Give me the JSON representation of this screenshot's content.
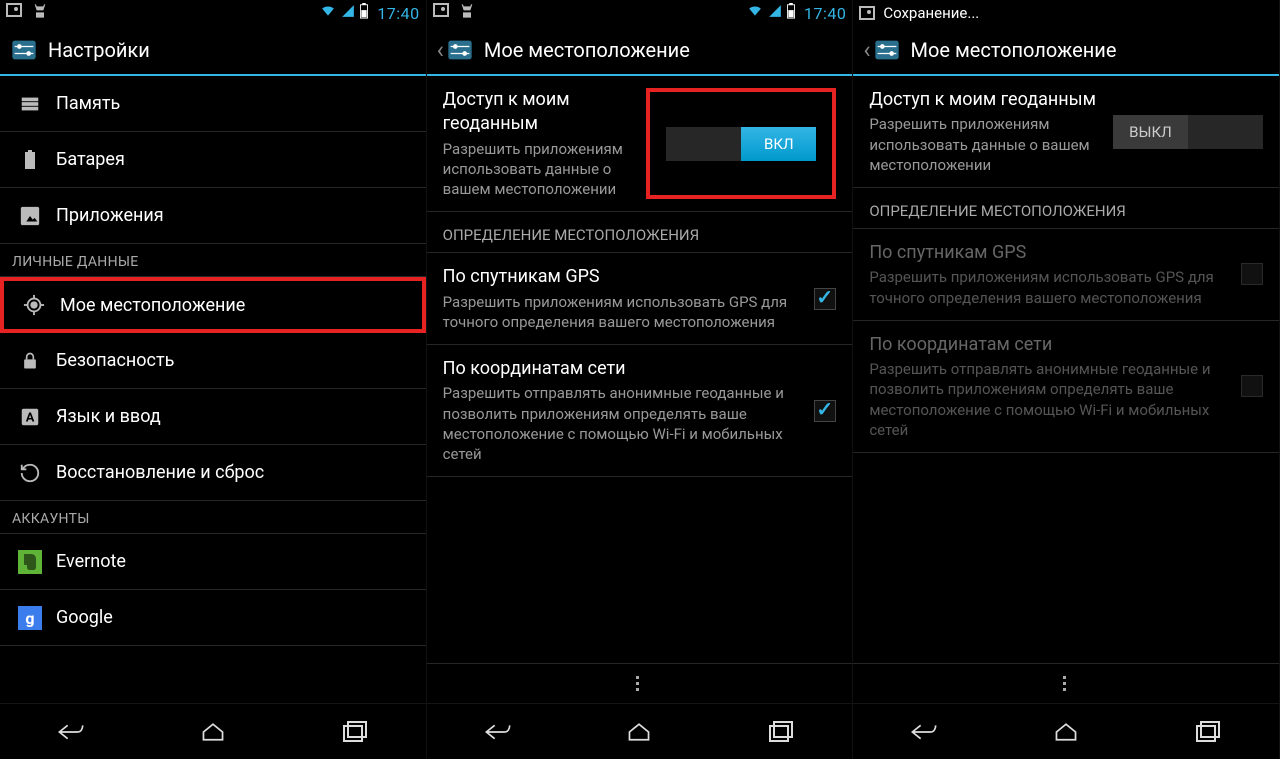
{
  "status": {
    "time": "17:40",
    "saving": "Сохранение..."
  },
  "screen1": {
    "title": "Настройки",
    "items": [
      {
        "icon": "memory",
        "label": "Память"
      },
      {
        "icon": "battery",
        "label": "Батарея"
      },
      {
        "icon": "apps",
        "label": "Приложения"
      }
    ],
    "section_personal": "ЛИЧНЫЕ ДАННЫЕ",
    "personal_items": [
      {
        "icon": "location",
        "label": "Мое местоположение"
      },
      {
        "icon": "lock",
        "label": "Безопасность"
      },
      {
        "icon": "lang",
        "label": "Язык и ввод"
      },
      {
        "icon": "restore",
        "label": "Восстановление и сброс"
      }
    ],
    "section_accounts": "АККАУНТЫ",
    "accounts": [
      {
        "icon": "evernote",
        "label": "Evernote"
      },
      {
        "icon": "google",
        "label": "Google"
      }
    ]
  },
  "screen2": {
    "title": "Мое местоположение",
    "access_title": "Доступ к моим геоданным",
    "access_sub": "Разрешить приложениям использовать данные о вашем местоположении",
    "toggle_on": "ВКЛ",
    "toggle_off": "ВЫКЛ",
    "section_sources": "ОПРЕДЕЛЕНИЕ МЕСТОПОЛОЖЕНИЯ",
    "gps_title": "По спутникам GPS",
    "gps_sub": "Разрешить приложениям использовать GPS для точного определения вашего местоположения",
    "net_title": "По координатам сети",
    "net_sub": "Разрешить отправлять анонимные геоданные и позволить приложениям определять ваше местоположение с помощью Wi-Fi и мобильных сетей"
  }
}
